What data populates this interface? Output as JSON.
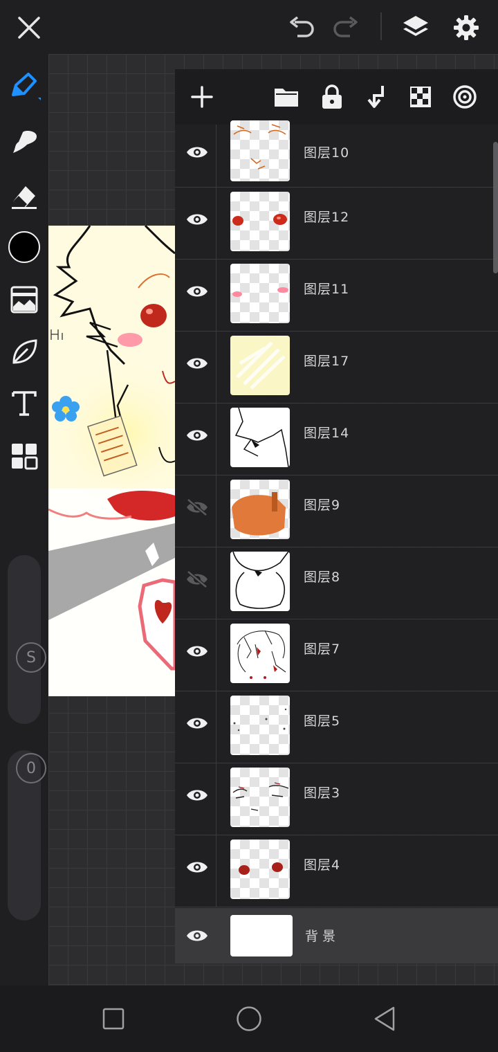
{
  "app": {
    "accent_color": "#1e90ff",
    "current_color": "#000000"
  },
  "topbar": {
    "icons": [
      "close-icon",
      "undo-icon",
      "redo-icon",
      "layers-icon",
      "settings-icon"
    ]
  },
  "toolbar": {
    "tools": [
      "brush-icon",
      "smudge-icon",
      "eraser-icon",
      "color-swatch",
      "adjust-icon",
      "lasso-icon",
      "text-icon",
      "grid-icon"
    ],
    "size_slider_label": "S",
    "opacity_slider_label": "0"
  },
  "layers_panel": {
    "header_icons": [
      "add-layer-icon",
      "folder-icon",
      "lock-icon",
      "merge-down-icon",
      "alpha-lock-icon",
      "blend-icon"
    ],
    "layers": [
      {
        "name": "图层10",
        "visible": true
      },
      {
        "name": "图层12",
        "visible": true
      },
      {
        "name": "图层11",
        "visible": true
      },
      {
        "name": "图层17",
        "visible": true
      },
      {
        "name": "图层14",
        "visible": true
      },
      {
        "name": "图层9",
        "visible": false
      },
      {
        "name": "图层8",
        "visible": false
      },
      {
        "name": "图层7",
        "visible": true
      },
      {
        "name": "图层5",
        "visible": true
      },
      {
        "name": "图层3",
        "visible": true
      },
      {
        "name": "图层4",
        "visible": true
      }
    ],
    "background_layer": {
      "name": "背景",
      "visible": true
    }
  },
  "artwork": {
    "text_hi": "Hi~"
  },
  "navbar": {
    "icons": [
      "recents-icon",
      "home-icon",
      "back-icon"
    ]
  }
}
